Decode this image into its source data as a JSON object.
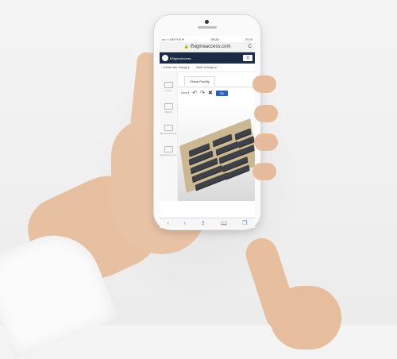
{
  "status_bar": {
    "carrier": "•••○○ KEYYO ✈",
    "time": "09:26",
    "battery": "74 %"
  },
  "browser": {
    "url": "ifsigmaaccess.com",
    "reload_icon": "C",
    "lock_icon": "lock-icon"
  },
  "app": {
    "brand_name": "6SigmaAccess",
    "menu_icon": "≡"
  },
  "subnav": {
    "item1": "Create new change ▸",
    "item2": "Make changes ▸"
  },
  "sidebar": {
    "items": [
      {
        "label": "Home"
      },
      {
        "label": "Objects"
      },
      {
        "label": "Browsing Boxes"
      },
      {
        "label": "Equipment Items"
      }
    ]
  },
  "tabs": {
    "active": "Virtual Facility"
  },
  "toolbar": {
    "view_label": "View ▾",
    "undo_icon": "↶",
    "redo_icon": "↷",
    "close_icon": "✖",
    "button_label": "3D"
  },
  "bottom_nav": {
    "back": "‹",
    "forward": "›",
    "share": "⇪",
    "bookmarks": "📖",
    "tabs": "❐"
  }
}
